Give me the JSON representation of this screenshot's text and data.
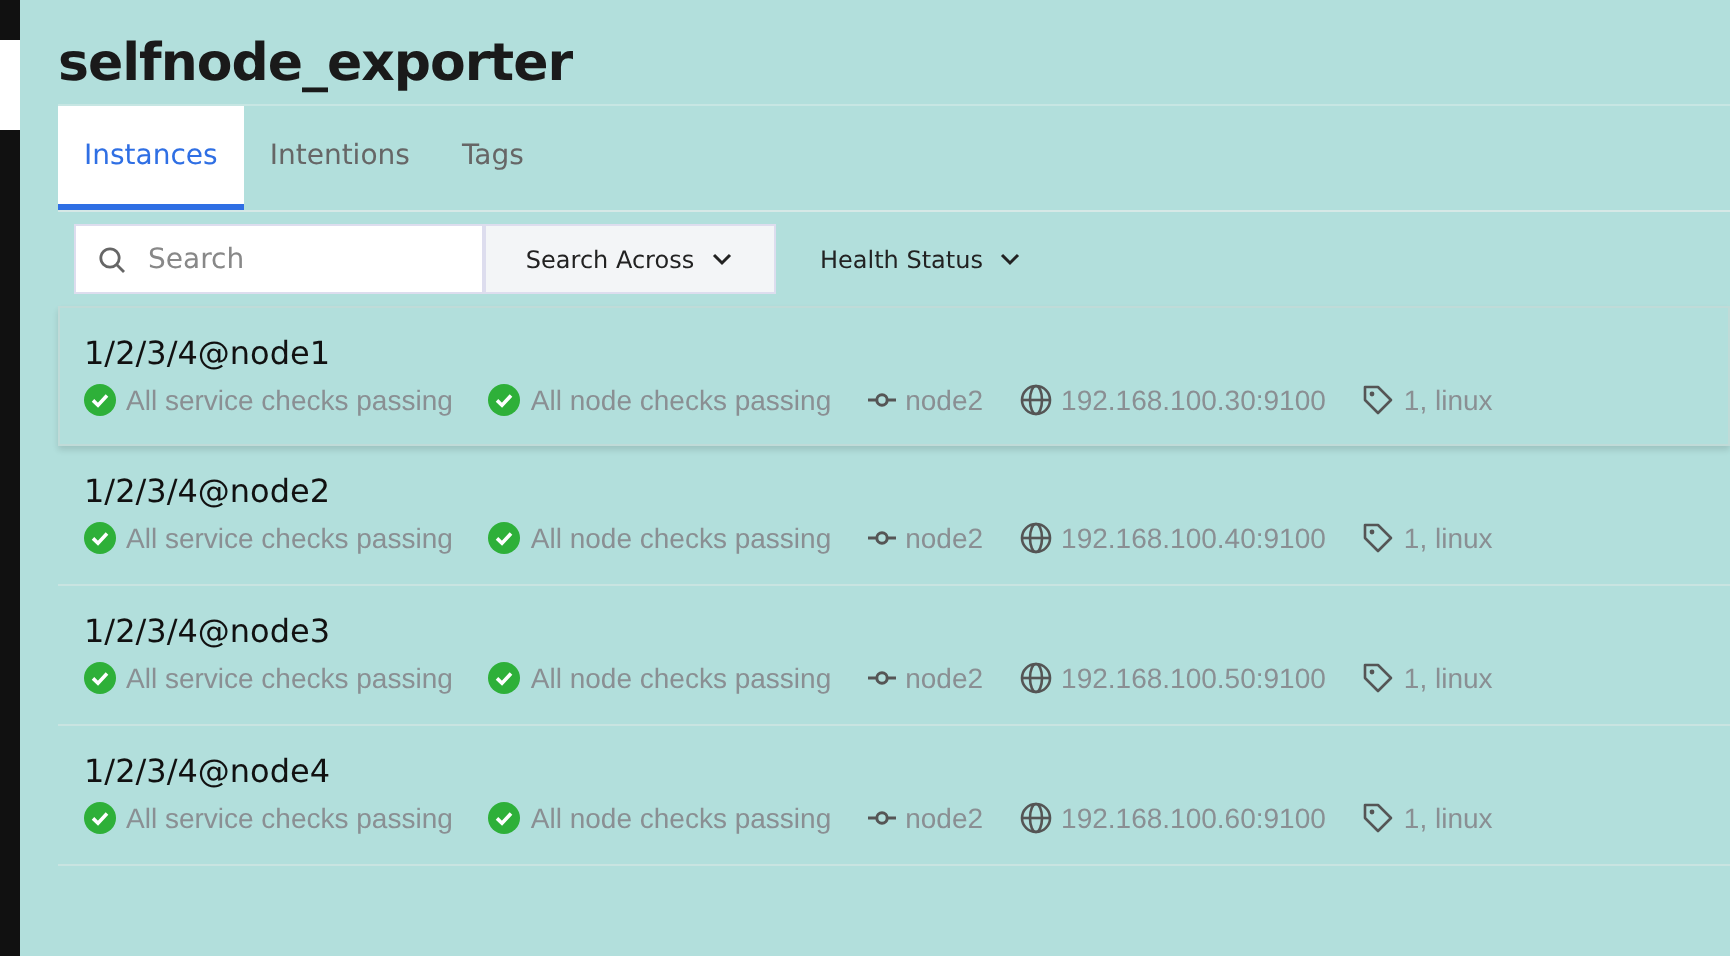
{
  "page": {
    "title": "selfnode_exporter"
  },
  "tabs": [
    {
      "label": "Instances",
      "selected": true
    },
    {
      "label": "Intentions",
      "selected": false
    },
    {
      "label": "Tags",
      "selected": false
    }
  ],
  "search": {
    "placeholder": "Search"
  },
  "filters": [
    {
      "kind": "boxed",
      "label": "Search Across"
    },
    {
      "kind": "plain",
      "label": "Health Status"
    }
  ],
  "instances": [
    {
      "name": "1/2/3/4@node1",
      "selected": true,
      "service_checks": "All service checks passing",
      "node_checks": "All node checks passing",
      "node": "node2",
      "address": "192.168.100.30:9100",
      "tags": "1, linux"
    },
    {
      "name": "1/2/3/4@node2",
      "selected": false,
      "service_checks": "All service checks passing",
      "node_checks": "All node checks passing",
      "node": "node2",
      "address": "192.168.100.40:9100",
      "tags": "1, linux"
    },
    {
      "name": "1/2/3/4@node3",
      "selected": false,
      "service_checks": "All service checks passing",
      "node_checks": "All node checks passing",
      "node": "node2",
      "address": "192.168.100.50:9100",
      "tags": "1, linux"
    },
    {
      "name": "1/2/3/4@node4",
      "selected": false,
      "service_checks": "All service checks passing",
      "node_checks": "All node checks passing",
      "node": "node2",
      "address": "192.168.100.60:9100",
      "tags": "1, linux"
    }
  ]
}
